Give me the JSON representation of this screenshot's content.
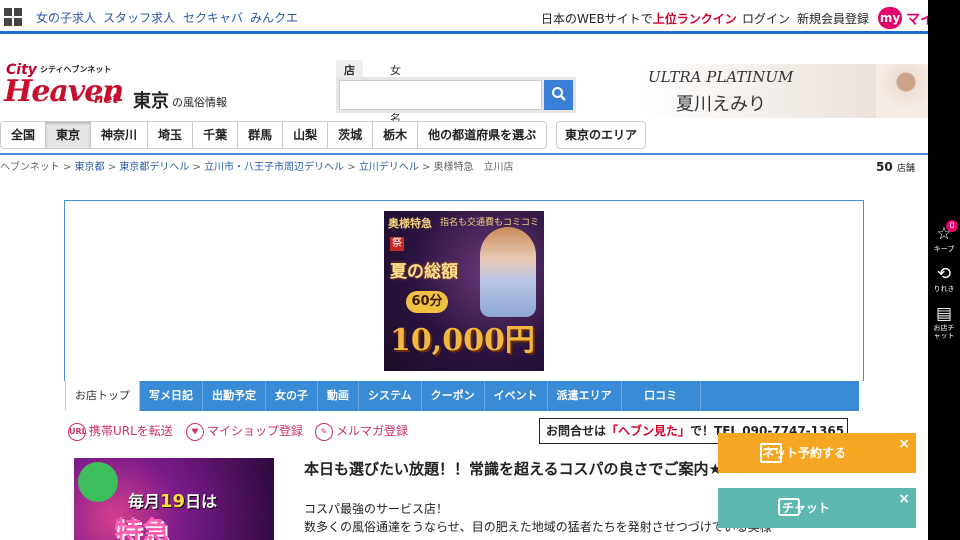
{
  "topbar": {
    "links": [
      "女の子求人",
      "スタッフ求人",
      "セクキャバ",
      "みんクエ"
    ],
    "ranking_prefix": "日本のWEBサイトで",
    "ranking_highlight": "上位ランクイン",
    "login": "ログイン",
    "register": "新規会員登録",
    "my_badge": "my",
    "my_text": "マイ"
  },
  "logo": {
    "line1": "City",
    "line2": "Heaven",
    "small": "シティヘブンネット",
    "net": "net"
  },
  "area": {
    "title": "東京",
    "subtitle": "の風俗情報"
  },
  "search": {
    "tabs": [
      "店名",
      "女の子名"
    ],
    "placeholder": ""
  },
  "banner": {
    "line1": "ULTRA PLATINUM",
    "line2": "夏川えみり"
  },
  "prefectures": [
    "全国",
    "東京",
    "神奈川",
    "埼玉",
    "千葉",
    "群馬",
    "山梨",
    "茨城",
    "栃木",
    "他の都道府県を選ぶ"
  ],
  "area_button": "東京のエリア",
  "breadcrumb": [
    "ヘブンネット",
    "東京都",
    "東京都デリヘル",
    "立川市・八王子市周辺デリヘル",
    "立川デリヘル",
    "奥様特急　立川店"
  ],
  "shop_count": {
    "number": "50",
    "unit": "店舗"
  },
  "promo": {
    "brand": "奥様特急",
    "tagline": "指名も交通費もコミコミ",
    "festival": "祭",
    "headline": "夏の総額",
    "minutes": "60分",
    "price": "10,000円"
  },
  "shop_nav": [
    "お店トップ",
    "写メ日記",
    "出勤予定",
    "女の子",
    "動画",
    "システム",
    "クーポン",
    "イベント",
    "派遣エリア",
    "口コミ"
  ],
  "actions": {
    "mobile_url": "携帯URLを転送",
    "myshop": "マイショップ登録",
    "mailmag": "メルマガ登録",
    "url_icon": "URL"
  },
  "inquiry": {
    "prefix": "お問合せは",
    "highlight": "「ヘブン見た」",
    "suffix": "で！TEL 090-7747-1365"
  },
  "thumb": {
    "line1_prefix": "毎月",
    "line1_num": "19",
    "line1_suffix": "日は",
    "line2": "特急"
  },
  "headline": {
    "title": "本日も選びたい放題！！常識を超えるコスパの良さでご案内★",
    "sub": "コスパ最強のサービス店！",
    "body": "数多くの風俗通達をうならせ、目の肥えた地域の猛者たちを発射させつづけている奥様"
  },
  "floating": {
    "reserve": "ネット予約する",
    "chat": "チャット",
    "close": "×"
  },
  "side": {
    "keep": "キープ",
    "keep_count": "0",
    "history": "りれき",
    "chat": "お店チャット"
  },
  "colors": {
    "accent": "#1e6fd0",
    "brand_red": "#c8102e",
    "pink": "#d12f6d",
    "orange": "#f5a623",
    "teal": "#5fb8b0"
  }
}
